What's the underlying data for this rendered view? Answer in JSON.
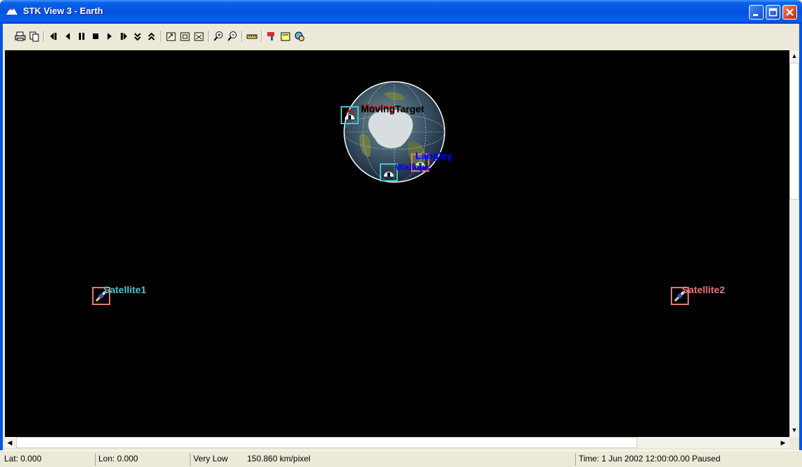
{
  "window": {
    "title": "STK View 3 - Earth"
  },
  "toolbar": {
    "buttons": [
      {
        "name": "print-button",
        "icon": "printer-icon"
      },
      {
        "name": "copy-button",
        "icon": "copy-icon"
      },
      {
        "name": "step-back-button",
        "icon": "step-back-icon"
      },
      {
        "name": "reverse-button",
        "icon": "reverse-icon"
      },
      {
        "name": "pause-button",
        "icon": "pause-icon"
      },
      {
        "name": "stop-button",
        "icon": "stop-icon"
      },
      {
        "name": "play-button",
        "icon": "play-icon"
      },
      {
        "name": "step-forward-button",
        "icon": "step-forward-icon"
      },
      {
        "name": "decrease-step-button",
        "icon": "double-down-icon"
      },
      {
        "name": "increase-step-button",
        "icon": "double-up-icon"
      },
      {
        "name": "zoom-in-button",
        "icon": "zoom-in-icon"
      },
      {
        "name": "zoom-out-button",
        "icon": "zoom-out-icon"
      },
      {
        "name": "measure-button",
        "icon": "ruler-icon"
      }
    ]
  },
  "scene": {
    "labels": {
      "satellite1": "Satellite1",
      "satellite2": "Satellite2",
      "target": "MovingTarget",
      "facility": "Langley",
      "facility2": "Wallops"
    },
    "colors": {
      "satellite1": "#4fc0c8",
      "satellite2": "#e37a7a",
      "target": "#000000",
      "facility": "#0000ff"
    }
  },
  "status": {
    "lat": "Lat: 0.000",
    "lon": "Lon: 0.000",
    "quality": "Very Low",
    "scale": "150.860 km/pixel",
    "time": "Time: 1 Jun 2002 12:00:00.00 Paused"
  }
}
